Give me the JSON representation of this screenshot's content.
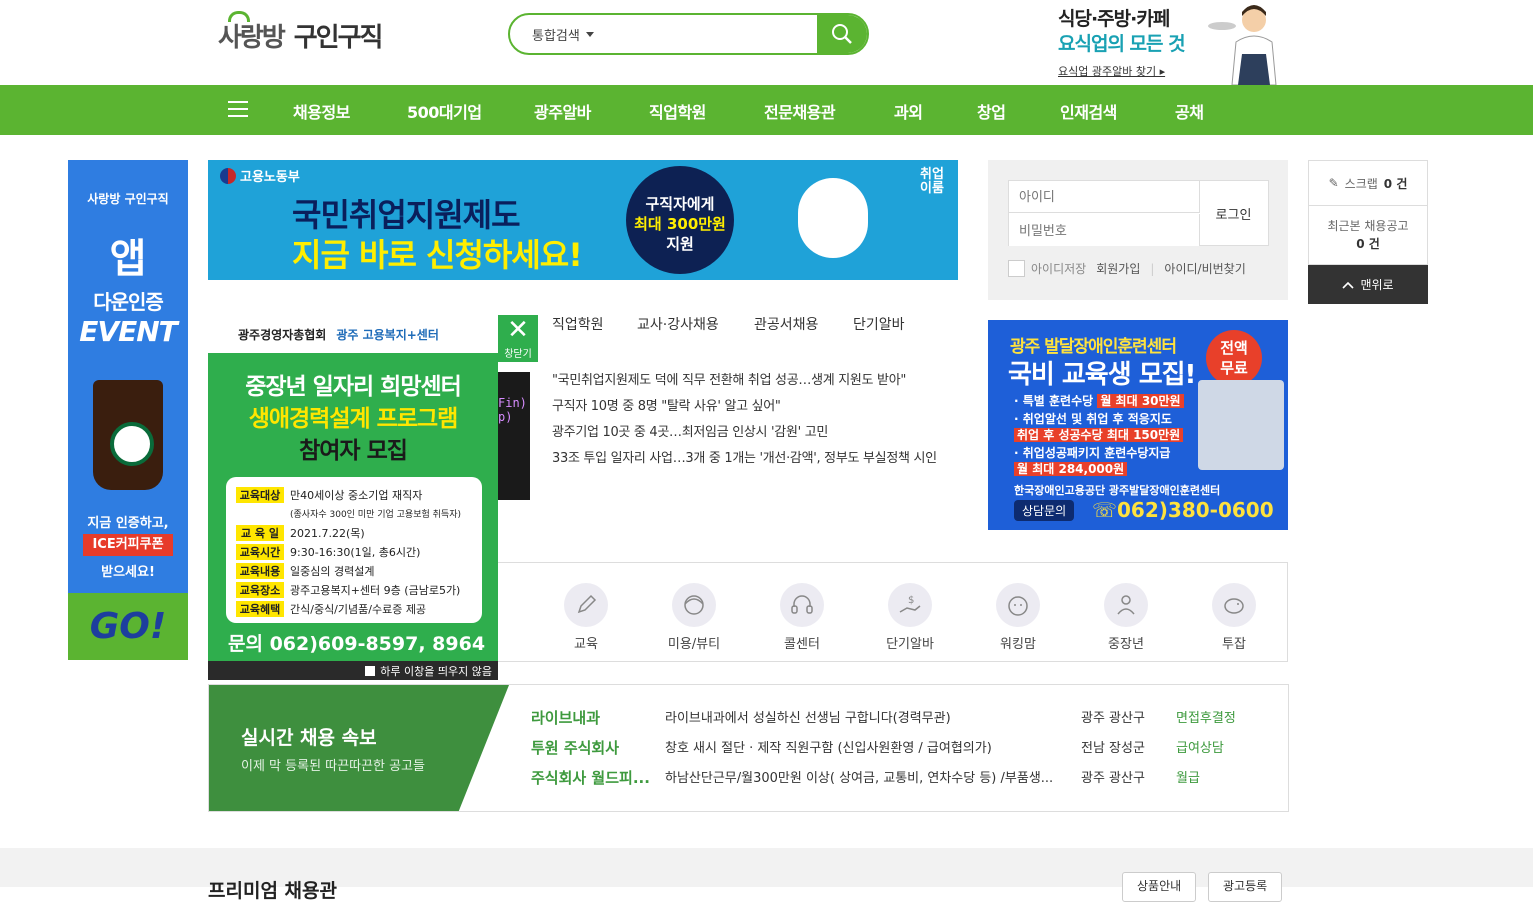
{
  "header": {
    "logo_part1": "사랑방",
    "logo_part2": "구인구직",
    "search_scope": "통합검색",
    "search_placeholder": "",
    "top_ad": {
      "line1": "식당·주방·카페",
      "line2": "요식업의 모든 것",
      "link": "요식업 광주알바 찾기 ▸"
    }
  },
  "nav": {
    "items": [
      "채용정보",
      "500대기업",
      "광주알바",
      "직업학원",
      "전문채용관",
      "과외",
      "창업",
      "인재검색",
      "공채"
    ]
  },
  "left_banner": {
    "brand": "사랑방 구인구직",
    "l1": "앱",
    "l2": "다운인증",
    "l3": "EVENT",
    "l4": "지금 인증하고,",
    "l5": "ICE커피쿠폰",
    "l6": "받으세요!",
    "go": "GO!"
  },
  "main_banner": {
    "org": "고용노동부",
    "line1": "국민취업지원제도",
    "line2": "지금 바로 신청하세요!",
    "circle1": "구직자에게",
    "circle2": "최대 300만원",
    "circle3": "지원",
    "tag": "취업이룸"
  },
  "login": {
    "id_placeholder": "아이디",
    "pw_placeholder": "비밀번호",
    "button": "로그인",
    "save_id": "아이디저장",
    "join": "회원가입",
    "find": "아이디/비번찾기"
  },
  "sidebar": {
    "scrap": "스크랩",
    "scrap_count": "0 건",
    "recent": "최근본 채용공고",
    "recent_count": "0 건",
    "top": "맨위로"
  },
  "tabs": [
    "직업학원",
    "교사·강사채용",
    "관공서채용",
    "단기알바"
  ],
  "news": [
    "\"국민취업지원제도 덕에 직무 전환해 취업 성공…생계 지원도 받아\"",
    "구직자 10명 중 8명 \"탈락 사유' 알고 싶어\"",
    "광주기업 10곳 중 4곳…최저임금 인상시 '감원' 고민",
    "33조 투입 일자리 사업…3개 중 1개는 '개선·감액', 정부도 부실정책 시인"
  ],
  "thumb_code": [
    "Fin)",
    "p)"
  ],
  "right_ad": {
    "title": "광주 발달장애인훈련센터",
    "headline": "국비 교육생 모집!",
    "badge1": "전액",
    "badge2": "무료",
    "l1": "· 특별 훈련수당",
    "l1b": "월 최대 30만원",
    "l2": "· 취업알선 및 취업 후 적응지도",
    "l3": "취업 후 성공수당 최대 150만원",
    "l4": "· 취업성공패키지 훈련수당지급",
    "l5": "월 최대 284,000원",
    "footer": "한국장애인고용공단 광주발달장애인훈련센터",
    "contact_label": "상담문의",
    "phone": "062)380-0600"
  },
  "categories": [
    "교육",
    "미용/뷰티",
    "콜센터",
    "단기알바",
    "워킹맘",
    "중장년",
    "투잡"
  ],
  "realtime": {
    "title": "실시간 채용 속보",
    "subtitle": "이제 막 등록된 따끈따끈한 공고들",
    "rows": [
      {
        "company": "라이브내과",
        "title": "라이브내과에서 성실하신 선생님 구합니다(경력무관)",
        "location": "광주 광산구",
        "pay": "면접후결정"
      },
      {
        "company": "투원 주식회사",
        "title": "창호 새시 절단 · 제작 직원구함 (신입사원환영 / 급여협의가)",
        "location": "전남 장성군",
        "pay": "급여상담"
      },
      {
        "company": "주식회사 월드피...",
        "title": "하남산단근무/월300만원 이상( 상여금, 교통비, 연차수당 등) /부품생...",
        "location": "광주 광산구",
        "pay": "월급"
      }
    ]
  },
  "popup": {
    "org1": "광주경영자총협회",
    "org2": "광주 고용복지+센터",
    "h1": "중장년 일자리 희망센터",
    "h2": "생애경력설계 프로그램",
    "h3": "참여자 모집",
    "rows": [
      {
        "label": "교육대상",
        "value": "만40세이상 중소기업 재직자"
      },
      {
        "label": "교 육 일",
        "value": "2021.7.22(목)"
      },
      {
        "label": "교육시간",
        "value": "9:30-16:30(1일, 총6시간)"
      },
      {
        "label": "교육내용",
        "value": "일중심의 경력설계"
      },
      {
        "label": "교육장소",
        "value": "광주고용복지+센터 9층 (금남로5가)"
      },
      {
        "label": "교육혜택",
        "value": "간식/중식/기념품/수료증 제공"
      }
    ],
    "sub": "(종사자수 300인 미만 기업 고용보험 취득자)",
    "contact": "문의 062)609-8597, 8964",
    "no_show": "하루 이창을 띄우지 않음",
    "close": "창닫기"
  },
  "bottom": {
    "title": "프리미엄 채용관",
    "btn1": "상품안내",
    "btn2": "광고등록"
  }
}
